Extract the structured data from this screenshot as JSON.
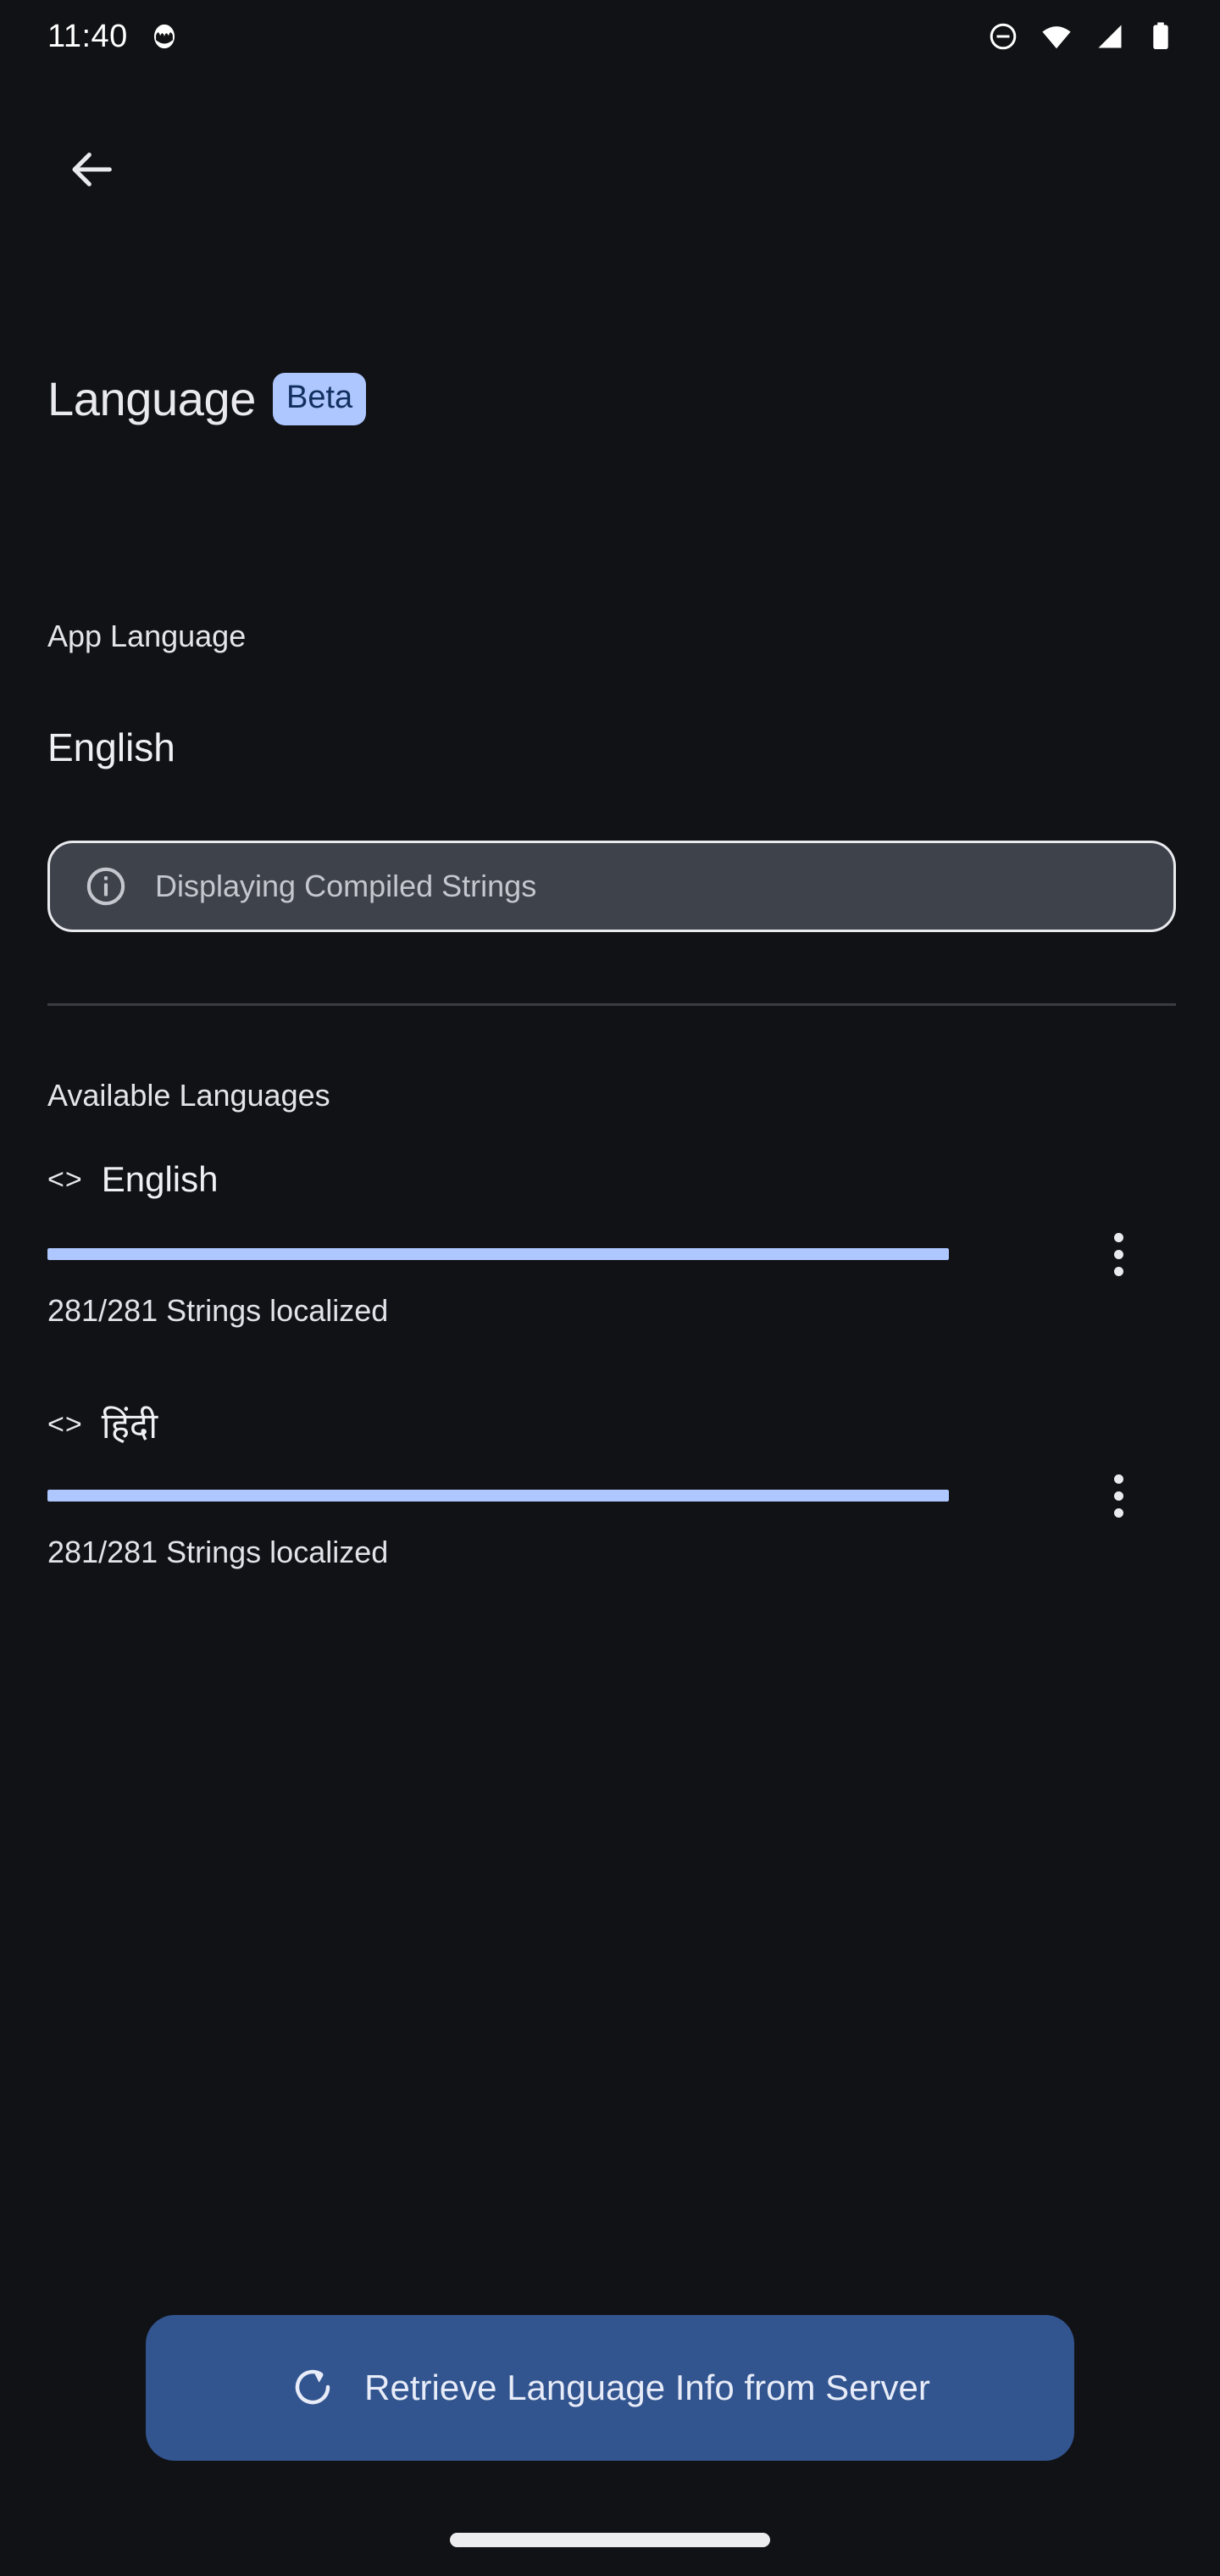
{
  "status_bar": {
    "time": "11:40",
    "left_icons": [
      "app-notification-icon"
    ],
    "right_icons": [
      "do-not-disturb-icon",
      "wifi-icon",
      "cellular-signal-icon",
      "battery-icon"
    ]
  },
  "nav": {
    "back_icon": "back-arrow-icon"
  },
  "header": {
    "title": "Language",
    "badge": "Beta",
    "badge_bg": "#AEC7FF",
    "badge_fg": "#12305F"
  },
  "app_language": {
    "label": "App Language",
    "value": "English"
  },
  "info_banner": {
    "icon": "info-icon",
    "text": "Displaying Compiled Strings",
    "bg": "#3E424B",
    "border": "#E9EAEE"
  },
  "available_languages": {
    "label": "Available Languages",
    "items": [
      {
        "code_icon": "<>",
        "name": "English",
        "progress_percent": 100,
        "localized_count": 281,
        "total_count": 281,
        "subtitle": "281/281 Strings localized",
        "overflow_icon": "more-vertical-icon"
      },
      {
        "code_icon": "<>",
        "name": "हिंदी",
        "progress_percent": 100,
        "localized_count": 281,
        "total_count": 281,
        "subtitle": "281/281 Strings localized",
        "overflow_icon": "more-vertical-icon"
      }
    ],
    "progress_color": "#AEC7FF"
  },
  "bottom_action": {
    "icon": "refresh-icon",
    "label": "Retrieve Language Info from Server",
    "bg": "#32548F"
  }
}
